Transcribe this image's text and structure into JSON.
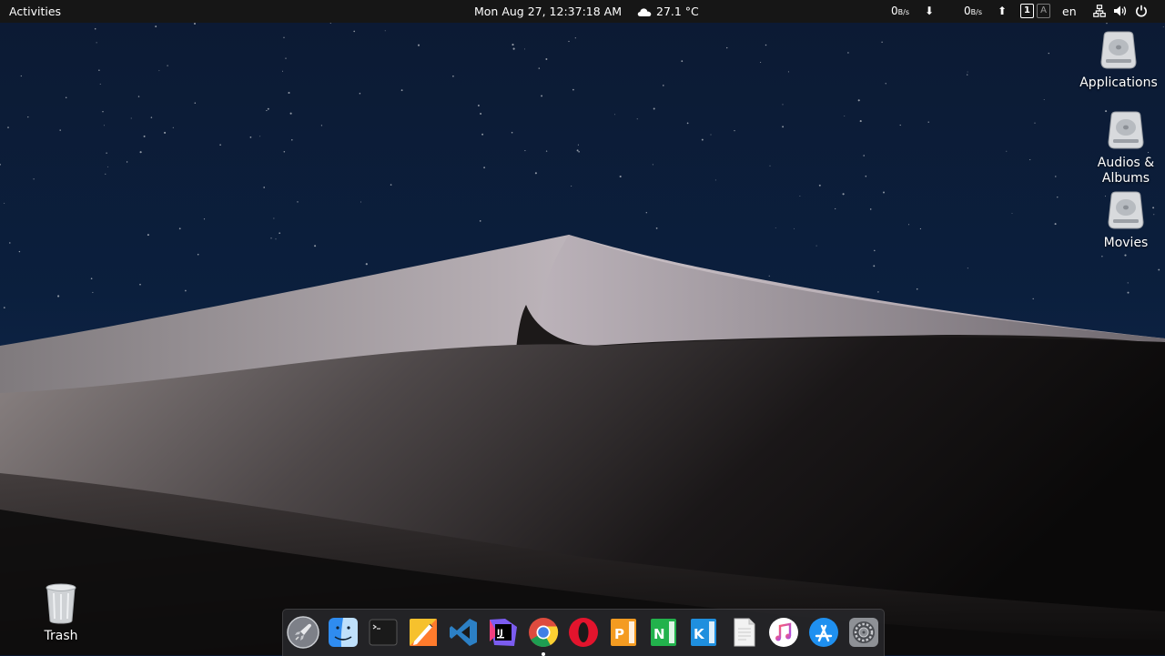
{
  "topbar": {
    "activities": "Activities",
    "clock": "Mon Aug 27, 12:37:18 AM",
    "weather": "27.1 °C",
    "net_down_value": "0",
    "net_down_unit": "B/s",
    "net_up_value": "0",
    "net_up_unit": "B/s",
    "workspace_active": "1",
    "workspace_inactive": "A",
    "language": "en",
    "icons": [
      "cloud-icon",
      "download-arrow-icon",
      "upload-arrow-icon",
      "network-icon",
      "volume-icon",
      "power-icon"
    ]
  },
  "desktop": {
    "applications_label": "Applications",
    "audios_label": "Audios & Albums",
    "movies_label": "Movies",
    "trash_label": "Trash"
  },
  "dock": {
    "apps": [
      "launchpad",
      "finder",
      "terminal",
      "sketch",
      "visual-studio-code",
      "intellij-idea",
      "chrome",
      "opera",
      "pages",
      "numbers",
      "keynote",
      "text-editor",
      "itunes",
      "app-store",
      "system-preferences"
    ],
    "running": "chrome"
  },
  "colors": {
    "topbar_bg": "#161616",
    "sky": "#0a1730",
    "dock_bg": "#28282c"
  }
}
